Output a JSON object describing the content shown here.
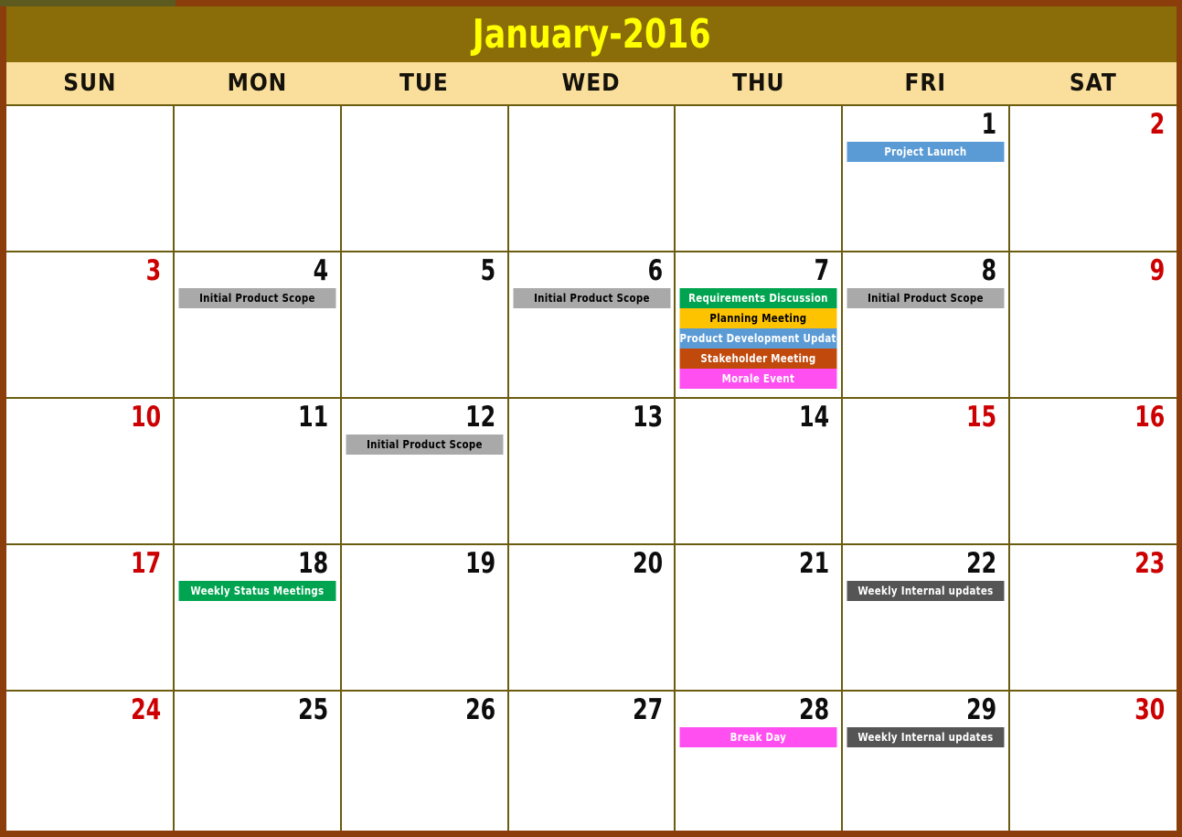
{
  "calendar": {
    "title": "January-2016",
    "weekday_headers": [
      "SUN",
      "MON",
      "TUE",
      "WED",
      "THU",
      "FRI",
      "SAT"
    ],
    "colors": {
      "title_bar_bg": "#8a6c09",
      "title_text": "#ffff00",
      "weekday_header_bg": "#fade9b",
      "weekday_header_text": "#14120b",
      "frame_brown": "#8c3d0c",
      "grid_olive": "#6b5c10",
      "weekday_number": "#0d0d0d",
      "weekend_number": "#cc0000",
      "cell_bg": "#ffffff"
    },
    "event_colors": {
      "gray": "#a9a9a9",
      "blue": "#5b9bd5",
      "green": "#00a450",
      "gold": "#fdc300",
      "brown": "#c1490c",
      "magenta": "#ff4ff0",
      "darkgray": "#555555"
    },
    "weeks": [
      {
        "days": [
          {
            "number": "",
            "weekend": true,
            "empty": true,
            "events": []
          },
          {
            "number": "",
            "weekend": false,
            "empty": true,
            "events": []
          },
          {
            "number": "",
            "weekend": false,
            "empty": true,
            "events": []
          },
          {
            "number": "",
            "weekend": false,
            "empty": true,
            "events": []
          },
          {
            "number": "",
            "weekend": false,
            "empty": true,
            "events": []
          },
          {
            "number": "1",
            "weekend": false,
            "empty": false,
            "events": [
              {
                "label": "Project Launch",
                "bg": "#5b9bd5",
                "fg": "#ffffff"
              }
            ]
          },
          {
            "number": "2",
            "weekend": true,
            "empty": false,
            "events": []
          }
        ]
      },
      {
        "days": [
          {
            "number": "3",
            "weekend": true,
            "empty": false,
            "events": []
          },
          {
            "number": "4",
            "weekend": false,
            "empty": false,
            "events": [
              {
                "label": "Initial Product Scope",
                "bg": "#a9a9a9",
                "fg": "#000000"
              }
            ]
          },
          {
            "number": "5",
            "weekend": false,
            "empty": false,
            "events": []
          },
          {
            "number": "6",
            "weekend": false,
            "empty": false,
            "events": [
              {
                "label": "Initial Product Scope",
                "bg": "#a9a9a9",
                "fg": "#000000"
              }
            ]
          },
          {
            "number": "7",
            "weekend": false,
            "empty": false,
            "events": [
              {
                "label": "Requirements Discussion",
                "bg": "#00a450",
                "fg": "#ffffff"
              },
              {
                "label": "Planning Meeting",
                "bg": "#fdc300",
                "fg": "#000000"
              },
              {
                "label": "Product Development Update",
                "bg": "#5b9bd5",
                "fg": "#ffffff"
              },
              {
                "label": "Stakeholder Meeting",
                "bg": "#c1490c",
                "fg": "#ffffff"
              },
              {
                "label": "Morale Event",
                "bg": "#ff4ff0",
                "fg": "#ffffff"
              }
            ]
          },
          {
            "number": "8",
            "weekend": false,
            "empty": false,
            "events": [
              {
                "label": "Initial Product Scope",
                "bg": "#a9a9a9",
                "fg": "#000000"
              }
            ]
          },
          {
            "number": "9",
            "weekend": true,
            "empty": false,
            "events": []
          }
        ]
      },
      {
        "days": [
          {
            "number": "10",
            "weekend": true,
            "empty": false,
            "events": []
          },
          {
            "number": "11",
            "weekend": false,
            "empty": false,
            "events": []
          },
          {
            "number": "12",
            "weekend": false,
            "empty": false,
            "events": [
              {
                "label": "Initial Product Scope",
                "bg": "#a9a9a9",
                "fg": "#000000"
              }
            ]
          },
          {
            "number": "13",
            "weekend": false,
            "empty": false,
            "events": []
          },
          {
            "number": "14",
            "weekend": false,
            "empty": false,
            "events": []
          },
          {
            "number": "15",
            "weekend": true,
            "empty": false,
            "events": []
          },
          {
            "number": "16",
            "weekend": true,
            "empty": false,
            "events": []
          }
        ]
      },
      {
        "days": [
          {
            "number": "17",
            "weekend": true,
            "empty": false,
            "events": []
          },
          {
            "number": "18",
            "weekend": false,
            "empty": false,
            "events": [
              {
                "label": "Weekly Status Meetings",
                "bg": "#00a450",
                "fg": "#ffffff"
              }
            ]
          },
          {
            "number": "19",
            "weekend": false,
            "empty": false,
            "events": []
          },
          {
            "number": "20",
            "weekend": false,
            "empty": false,
            "events": []
          },
          {
            "number": "21",
            "weekend": false,
            "empty": false,
            "events": []
          },
          {
            "number": "22",
            "weekend": false,
            "empty": false,
            "events": [
              {
                "label": "Weekly Internal updates",
                "bg": "#555555",
                "fg": "#ffffff"
              }
            ]
          },
          {
            "number": "23",
            "weekend": true,
            "empty": false,
            "events": []
          }
        ]
      },
      {
        "days": [
          {
            "number": "24",
            "weekend": true,
            "empty": false,
            "events": []
          },
          {
            "number": "25",
            "weekend": false,
            "empty": false,
            "events": []
          },
          {
            "number": "26",
            "weekend": false,
            "empty": false,
            "events": []
          },
          {
            "number": "27",
            "weekend": false,
            "empty": false,
            "events": []
          },
          {
            "number": "28",
            "weekend": false,
            "empty": false,
            "events": [
              {
                "label": "Break Day",
                "bg": "#ff4ff0",
                "fg": "#ffffff"
              }
            ]
          },
          {
            "number": "29",
            "weekend": false,
            "empty": false,
            "events": [
              {
                "label": "Weekly Internal updates",
                "bg": "#555555",
                "fg": "#ffffff"
              }
            ]
          },
          {
            "number": "30",
            "weekend": true,
            "empty": false,
            "events": []
          }
        ]
      }
    ]
  }
}
